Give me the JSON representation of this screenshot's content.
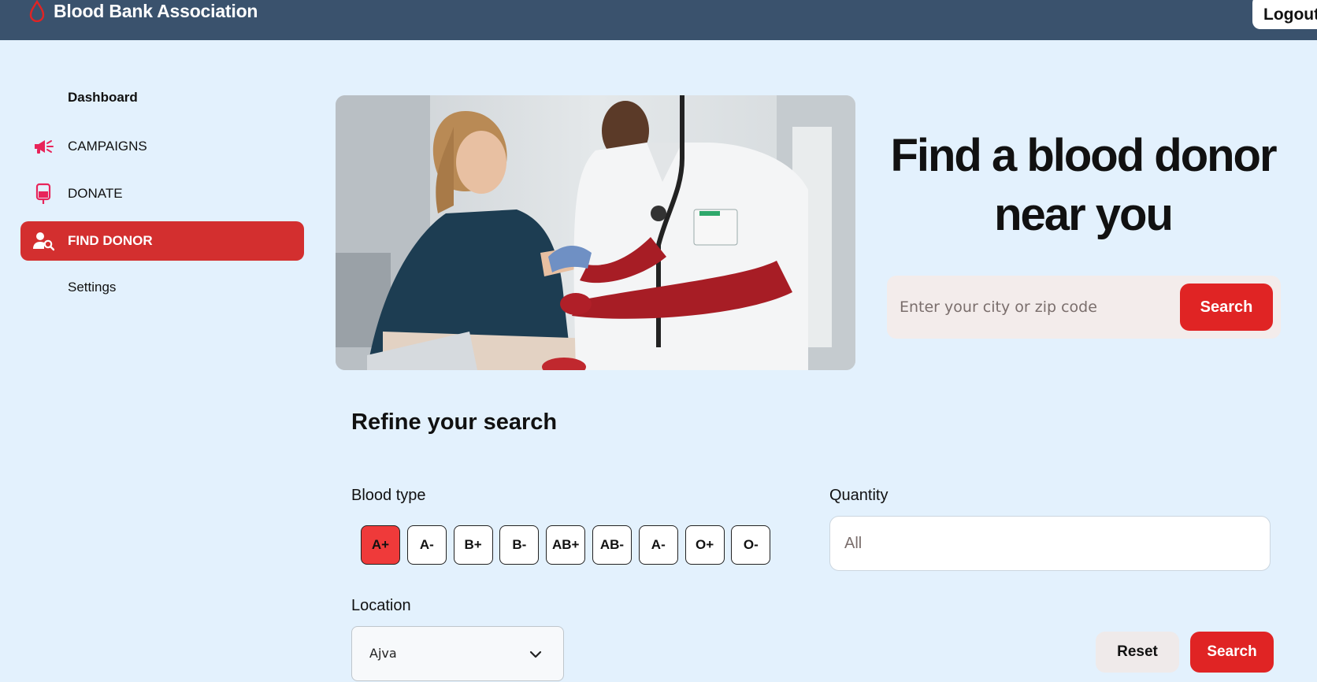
{
  "header": {
    "brand": "Blood Bank Association",
    "logout_label": "Logout",
    "bg_color": "#3a526d"
  },
  "sidebar": {
    "items": [
      {
        "label": "Dashboard",
        "icon": "none",
        "active": false
      },
      {
        "label": "CAMPAIGNS",
        "icon": "megaphone-icon",
        "active": false
      },
      {
        "label": "DONATE",
        "icon": "blood-bag-icon",
        "active": false
      },
      {
        "label": "FIND DONOR",
        "icon": "person-search-icon",
        "active": true
      },
      {
        "label": "Settings",
        "icon": "none",
        "active": false
      }
    ]
  },
  "hero": {
    "headline_line1": "Find a blood donor",
    "headline_line2": "near you",
    "image": "doctor-drawing-blood-photo"
  },
  "search": {
    "placeholder": "Enter your city or zip code",
    "button_label": "Search"
  },
  "refine": {
    "title": "Refine your search",
    "blood_type_label": "Blood type",
    "blood_types": [
      "A+",
      "A-",
      "B+",
      "B-",
      "AB+",
      "AB-",
      "A-",
      "O+",
      "O-"
    ],
    "selected_blood_type": "A+",
    "quantity_label": "Quantity",
    "quantity_value": "All",
    "location_label": "Location",
    "location_value": "Ajva",
    "reset_label": "Reset",
    "search_label": "Search"
  },
  "colors": {
    "accent": "#e02424",
    "active_nav": "#d32f2f",
    "page_bg": "#e3f1fd"
  }
}
